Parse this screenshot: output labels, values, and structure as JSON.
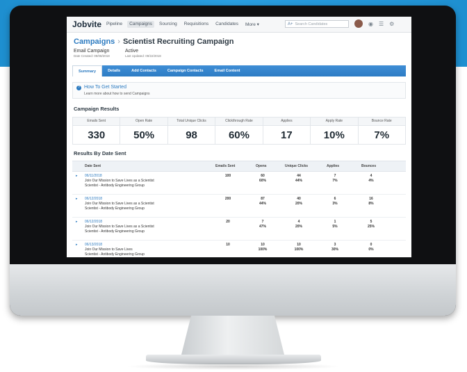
{
  "nav": {
    "logo": "Jobvite",
    "items": [
      "Pipeline",
      "Campaigns",
      "Sourcing",
      "Requisitions",
      "Candidates",
      "More"
    ],
    "search_placeholder": "Search Candidates"
  },
  "header": {
    "breadcrumb": "Campaigns",
    "title": "Scientist Recruiting Campaign",
    "meta": [
      {
        "value": "Email Campaign",
        "sub": "Date Created: 09/08/2018"
      },
      {
        "value": "Active",
        "sub": "Last Updated: 09/22/2018"
      }
    ]
  },
  "tabs": [
    "Summary",
    "Details",
    "Add Contacts",
    "Campaign Contacts",
    "Email Content"
  ],
  "help": {
    "title": "How To Get Started",
    "subtitle": "Learn more about how to send Campaigns"
  },
  "campaign_results": {
    "heading": "Campaign Results",
    "metrics": [
      {
        "label": "Emails Sent",
        "value": "330"
      },
      {
        "label": "Open Rate",
        "value": "50%"
      },
      {
        "label": "Total Unique Clicks",
        "value": "98"
      },
      {
        "label": "Clickthrough Rate",
        "value": "60%"
      },
      {
        "label": "Applies",
        "value": "17"
      },
      {
        "label": "Apply Rate",
        "value": "10%"
      },
      {
        "label": "Bounce Rate",
        "value": "7%"
      }
    ]
  },
  "results_by_date": {
    "heading": "Results By Date Sent",
    "columns": [
      "Date Sent",
      "Emails Sent",
      "Opens",
      "Unique Clicks",
      "Applies",
      "Bounces"
    ],
    "rows": [
      {
        "date": "06/11/2018",
        "line2": "Join Our Mission to Save Lives as a Scientist",
        "line3": "Scientist - Antibody Engineering Group",
        "sent": "100",
        "opens": "60",
        "opens_pct": "60%",
        "clicks": "44",
        "clicks_pct": "44%",
        "applies": "7",
        "applies_pct": "7%",
        "bounces": "4",
        "bounces_pct": "4%"
      },
      {
        "date": "06/12/2018",
        "line2": "Join Our Mission to Save Lives as a Scientist",
        "line3": "Scientist - Antibody Engineering Group",
        "sent": "200",
        "opens": "87",
        "opens_pct": "44%",
        "clicks": "40",
        "clicks_pct": "20%",
        "applies": "6",
        "applies_pct": "3%",
        "bounces": "16",
        "bounces_pct": "8%"
      },
      {
        "date": "06/12/2018",
        "line2": "Join Our Mission to Save Lives as a Scientist",
        "line3": "Scientist - Antibody Engineering Group",
        "sent": "20",
        "opens": "7",
        "opens_pct": "47%",
        "clicks": "4",
        "clicks_pct": "20%",
        "applies": "1",
        "applies_pct": "5%",
        "bounces": "5",
        "bounces_pct": "25%"
      },
      {
        "date": "06/13/2018",
        "line2": "Join Our Mission to Save Lives",
        "line3": "Scientist - Antibody Engineering Group",
        "sent": "10",
        "opens": "10",
        "opens_pct": "100%",
        "clicks": "10",
        "clicks_pct": "100%",
        "applies": "3",
        "applies_pct": "30%",
        "bounces": "0",
        "bounces_pct": "0%"
      }
    ]
  }
}
